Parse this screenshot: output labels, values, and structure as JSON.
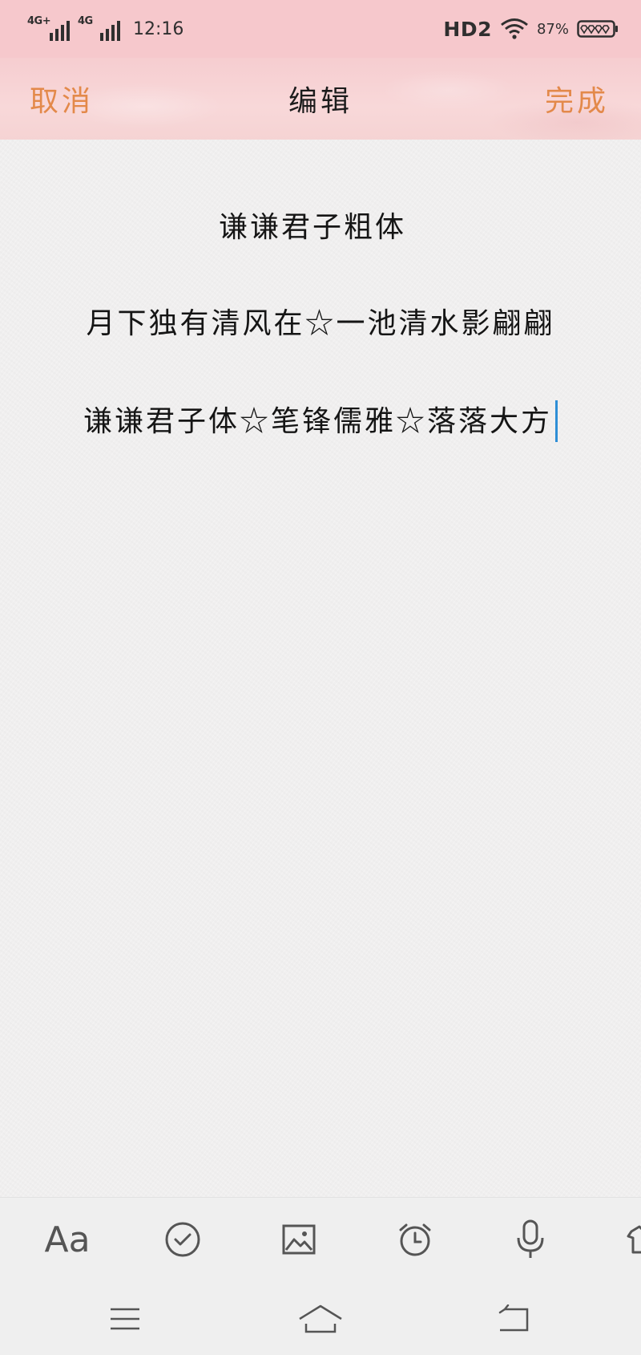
{
  "status_bar": {
    "signal1_label": "4G+",
    "signal2_label": "4G",
    "time": "12:16",
    "hd_label": "HD2",
    "battery_percent": "87%"
  },
  "header": {
    "cancel_label": "取消",
    "title": "编辑",
    "done_label": "完成"
  },
  "editor": {
    "lines": [
      "谦谦君子粗体",
      "月下独有清风在☆一池清水影翩翩",
      "谦谦君子体☆笔锋儒雅☆落落大方"
    ]
  },
  "toolbar": {
    "format_label": "Aa",
    "icons": [
      "checklist-icon",
      "image-icon",
      "alarm-icon",
      "microphone-icon",
      "more-icon"
    ]
  },
  "colors": {
    "status_bg": "#f6c8cc",
    "accent": "#e3894a",
    "caret": "#2e8ed6",
    "icon": "#555555"
  }
}
